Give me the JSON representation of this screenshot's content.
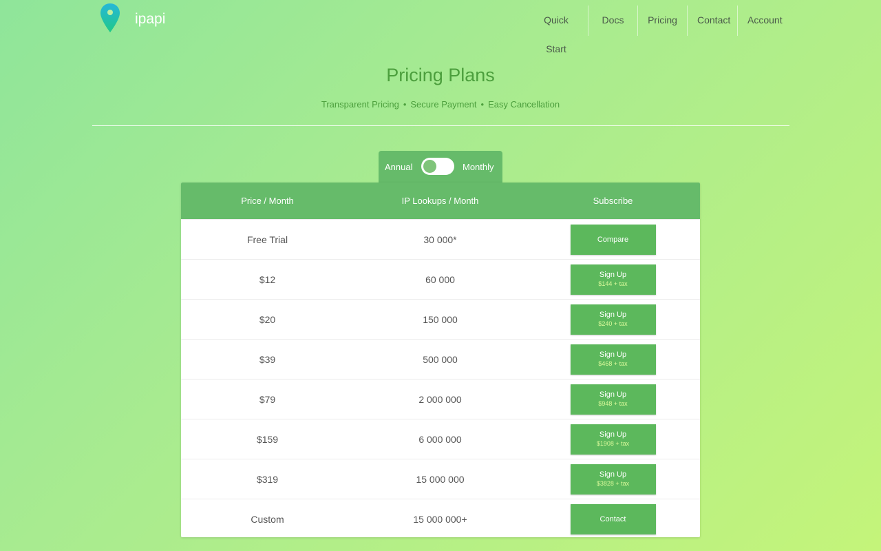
{
  "header": {
    "brand": "ipapi",
    "nav": [
      "Quick Start",
      "Docs",
      "Pricing",
      "Contact",
      "Account"
    ]
  },
  "hero": {
    "title": "Pricing Plans",
    "subtitle_items": [
      "Transparent Pricing",
      "Secure Payment",
      "Easy Cancellation"
    ],
    "separator": "•"
  },
  "billing_toggle": {
    "left": "Annual",
    "right": "Monthly",
    "selected": "Annual"
  },
  "table": {
    "headers": [
      "Price / Month",
      "IP Lookups / Month",
      "Subscribe"
    ],
    "rows": [
      {
        "price": "Free Trial",
        "lookups": "30 000*",
        "button": "Compare",
        "sub": ""
      },
      {
        "price": "$12",
        "lookups": "60 000",
        "button": "Sign Up",
        "sub": "$144 + tax"
      },
      {
        "price": "$20",
        "lookups": "150 000",
        "button": "Sign Up",
        "sub": "$240 + tax"
      },
      {
        "price": "$39",
        "lookups": "500 000",
        "button": "Sign Up",
        "sub": "$468 + tax"
      },
      {
        "price": "$79",
        "lookups": "2 000 000",
        "button": "Sign Up",
        "sub": "$948 + tax"
      },
      {
        "price": "$159",
        "lookups": "6 000 000",
        "button": "Sign Up",
        "sub": "$1908 + tax"
      },
      {
        "price": "$319",
        "lookups": "15 000 000",
        "button": "Sign Up",
        "sub": "$3828 + tax"
      },
      {
        "price": "Custom",
        "lookups": "15 000 000+",
        "button": "Contact",
        "sub": ""
      }
    ]
  },
  "colors": {
    "accent_green": "#66bb6a",
    "button_green": "#5cb85c",
    "title_green": "#4c9f3d",
    "tax_text": "#d9f99a"
  }
}
